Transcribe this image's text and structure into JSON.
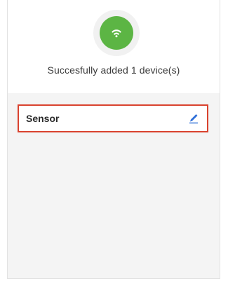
{
  "header": {
    "status_icon": "wifi-icon",
    "success_message": "Succesfully added 1 device(s)"
  },
  "devices": [
    {
      "name": "Sensor",
      "edit_icon": "pencil-icon"
    }
  ],
  "colors": {
    "success_green": "#5cb544",
    "highlight_border": "#d9422e",
    "edit_blue": "#2f6fd8",
    "list_background": "#f4f4f4"
  }
}
